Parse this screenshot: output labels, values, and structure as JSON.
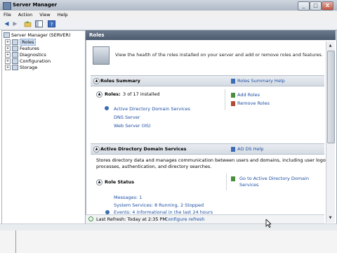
{
  "window": {
    "title": "Server Manager",
    "buttons": [
      "_",
      "□",
      "X"
    ]
  },
  "menu": [
    "File",
    "Action",
    "View",
    "Help"
  ],
  "tree": [
    {
      "label": "Server Manager (SERVER)",
      "indent": 0,
      "expander": "",
      "selected": false
    },
    {
      "label": "Roles",
      "indent": 1,
      "expander": "+",
      "selected": true
    },
    {
      "label": "Features",
      "indent": 1,
      "expander": "+",
      "selected": false
    },
    {
      "label": "Diagnostics",
      "indent": 1,
      "expander": "+",
      "selected": false
    },
    {
      "label": "Configuration",
      "indent": 1,
      "expander": "+",
      "selected": false
    },
    {
      "label": "Storage",
      "indent": 1,
      "expander": "+",
      "selected": false
    }
  ],
  "pane": {
    "title": "Roles",
    "intro": "View the health of the roles installed on your server and add or remove roles and features."
  },
  "roles_summary": {
    "title": "Roles Summary",
    "help": "Roles Summary Help",
    "roles_label": "Roles:",
    "roles_count": "3 of 17 installed",
    "roles": [
      "Active Directory Domain Services",
      "DNS Server",
      "Web Server (IIS)"
    ],
    "actions": [
      "Add Roles",
      "Remove Roles"
    ]
  },
  "adds": {
    "title": "Active Directory Domain Services",
    "help": "AD DS Help",
    "description": [
      "Stores directory data and manages communication between users and domains, including user logon",
      "processes, authentication, and directory searches."
    ],
    "role_status": "Role Status",
    "goto": [
      "Go to Active Directory Domain",
      "Services"
    ],
    "messages": "Messages: 1",
    "system_services": "System Services: 8 Running, 2 Stopped",
    "events": "Events: 4 informational in the last 24 hours"
  },
  "status": {
    "last_refresh": "Last Refresh: Today at 2:35 PM",
    "configure": "Configure refresh"
  }
}
